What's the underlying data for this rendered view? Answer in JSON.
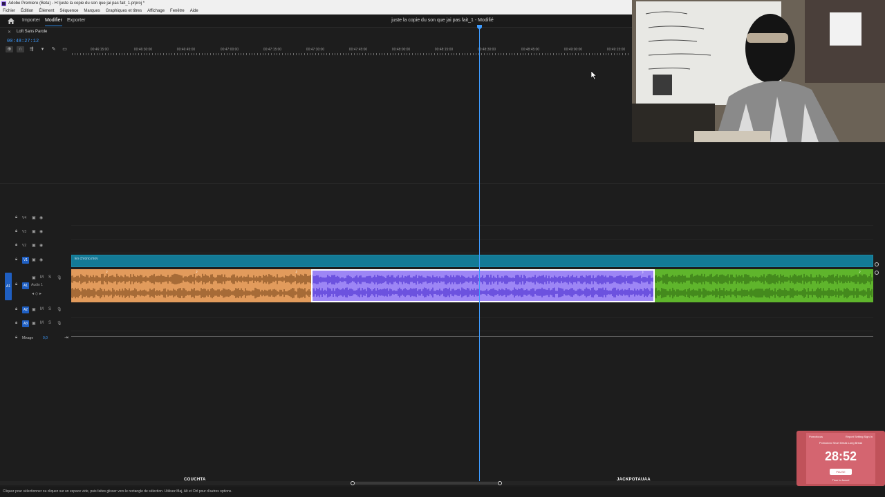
{
  "window": {
    "title": "Adobe Premiere (Beta) - H:\\juste la copie du son que jai pas fait_1.prproj *"
  },
  "menu": [
    "Fichier",
    "Édition",
    "Élément",
    "Séquence",
    "Marques",
    "Graphiques et titres",
    "Affichage",
    "Fenêtre",
    "Aide"
  ],
  "workspace": {
    "tabs": [
      {
        "label": "Importer"
      },
      {
        "label": "Modifier"
      },
      {
        "label": "Exporter"
      }
    ],
    "active": "Modifier",
    "project_title": "juste la copie du son que jai pas fait_1 - Modifié"
  },
  "sequence": {
    "tab_label": "Loft Sans Parole",
    "timecode": "00:48:27:12",
    "ruler": [
      "00:46:15:00",
      "00:46:30:00",
      "00:46:45:00",
      "00:47:00:00",
      "00:47:15:00",
      "00:47:30:00",
      "00:47:45:00",
      "00:48:00:00",
      "00:48:15:00",
      "00:48:30:00",
      "00:48:45:00",
      "00:49:00:00",
      "00:49:15:00"
    ],
    "playhead_position": 0.732
  },
  "tracks": {
    "video": [
      {
        "name": "V4"
      },
      {
        "name": "V3"
      },
      {
        "name": "V2"
      },
      {
        "name": "V1"
      }
    ],
    "audio": [
      {
        "name": "A1",
        "label": "Audio 1"
      },
      {
        "name": "A2"
      },
      {
        "name": "A3"
      }
    ],
    "source_v": "V1",
    "source_a": "A1",
    "mix": {
      "label": "Mixage",
      "value": "0,0"
    }
  },
  "clips": {
    "video_label": "En chrono.mov",
    "audio_colors": {
      "orange": "#e29b5c",
      "purple": "#9d86f5",
      "green": "#5fb52c"
    }
  },
  "status": {
    "text": "Cliquez pour sélectionner ou cliquez sur un espace vide, puis faites glisser vers le rectangle de sélection. Utilisez Maj, Alt et Ctrl pour d'autres options."
  },
  "overlay": {
    "left_name": "COUCHTA",
    "right_name": "JACKPOTAUAA"
  },
  "timer": {
    "brand": "Pomofocus",
    "nav": "Report  Setting  Sign In",
    "modes": "Pomodoro  Short Break  Long Break",
    "time": "28:52",
    "button": "PAUSE",
    "subtitle": "Time to focus!"
  },
  "colors": {
    "accent": "#3d9bff",
    "video_clip": "#137a96",
    "track_select": "#1f5fc2"
  }
}
